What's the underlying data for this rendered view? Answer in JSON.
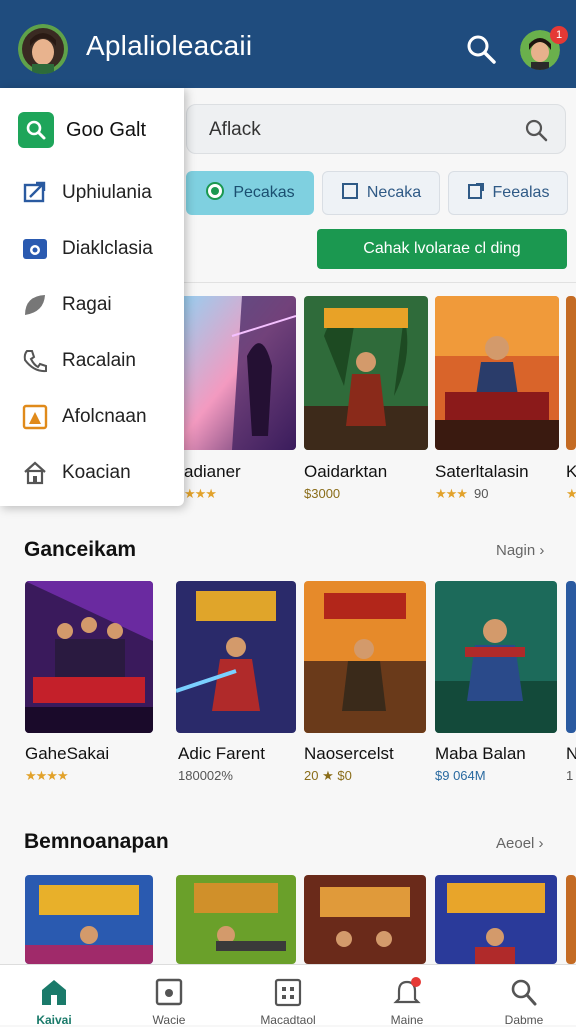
{
  "header": {
    "title": "Aplalioleacaii",
    "notification_count": "1"
  },
  "search": {
    "placeholder": "Aflack"
  },
  "filters": [
    {
      "label": "Pecakas",
      "icon": "radio-icon"
    },
    {
      "label": "Necaka",
      "icon": "square-icon"
    },
    {
      "label": "Feealas",
      "icon": "export-icon"
    }
  ],
  "cta": {
    "label": "Cahak lvolarae cl ding"
  },
  "drawer": {
    "header": "Goo Galt",
    "items": [
      {
        "label": "Uphiulania",
        "icon": "send-icon"
      },
      {
        "label": "Diaklclasia",
        "icon": "camera-icon"
      },
      {
        "label": "Ragai",
        "icon": "leaf-icon"
      },
      {
        "label": "Racalain",
        "icon": "phone-icon"
      },
      {
        "label": "Afolcnaan",
        "icon": "photo-icon"
      },
      {
        "label": "Koacian",
        "icon": "home-icon"
      }
    ]
  },
  "row1": [
    {
      "title": "adianer",
      "stars": "★★★",
      "sub": ""
    },
    {
      "title": "Oaidarktan",
      "stars": "",
      "sub": "$3000"
    },
    {
      "title": "Saterltalasin",
      "stars": "★★★",
      "sub": "90"
    },
    {
      "title": "K",
      "stars": "★",
      "sub": ""
    }
  ],
  "section2": {
    "title": "Ganceikam",
    "more": "Nagin"
  },
  "row2": [
    {
      "title": "GaheSakai",
      "stars": "★★★★",
      "sub": ""
    },
    {
      "title": "Adic Farent",
      "stars": "",
      "sub": "180002%"
    },
    {
      "title": "Naosercelst",
      "stars": "",
      "sub": "20 ★ $0"
    },
    {
      "title": "Maba Balan",
      "stars": "",
      "sub": "$9 064M"
    },
    {
      "title": "N",
      "stars": "",
      "sub": "1"
    }
  ],
  "section3": {
    "title": "Bemnoanapan",
    "more": "Aeoel"
  },
  "nav": [
    {
      "label": "Kaivai",
      "icon": "home-icon",
      "active": true
    },
    {
      "label": "Wacie",
      "icon": "wallet-icon"
    },
    {
      "label": "Macadtaol",
      "icon": "calendar-icon"
    },
    {
      "label": "Maine",
      "icon": "bell-icon"
    },
    {
      "label": "Dabme",
      "icon": "search-icon"
    }
  ],
  "colors": {
    "appbar": "#1f4c7e",
    "accent_green": "#1b9850",
    "chip_active": "#7fd0e0"
  }
}
